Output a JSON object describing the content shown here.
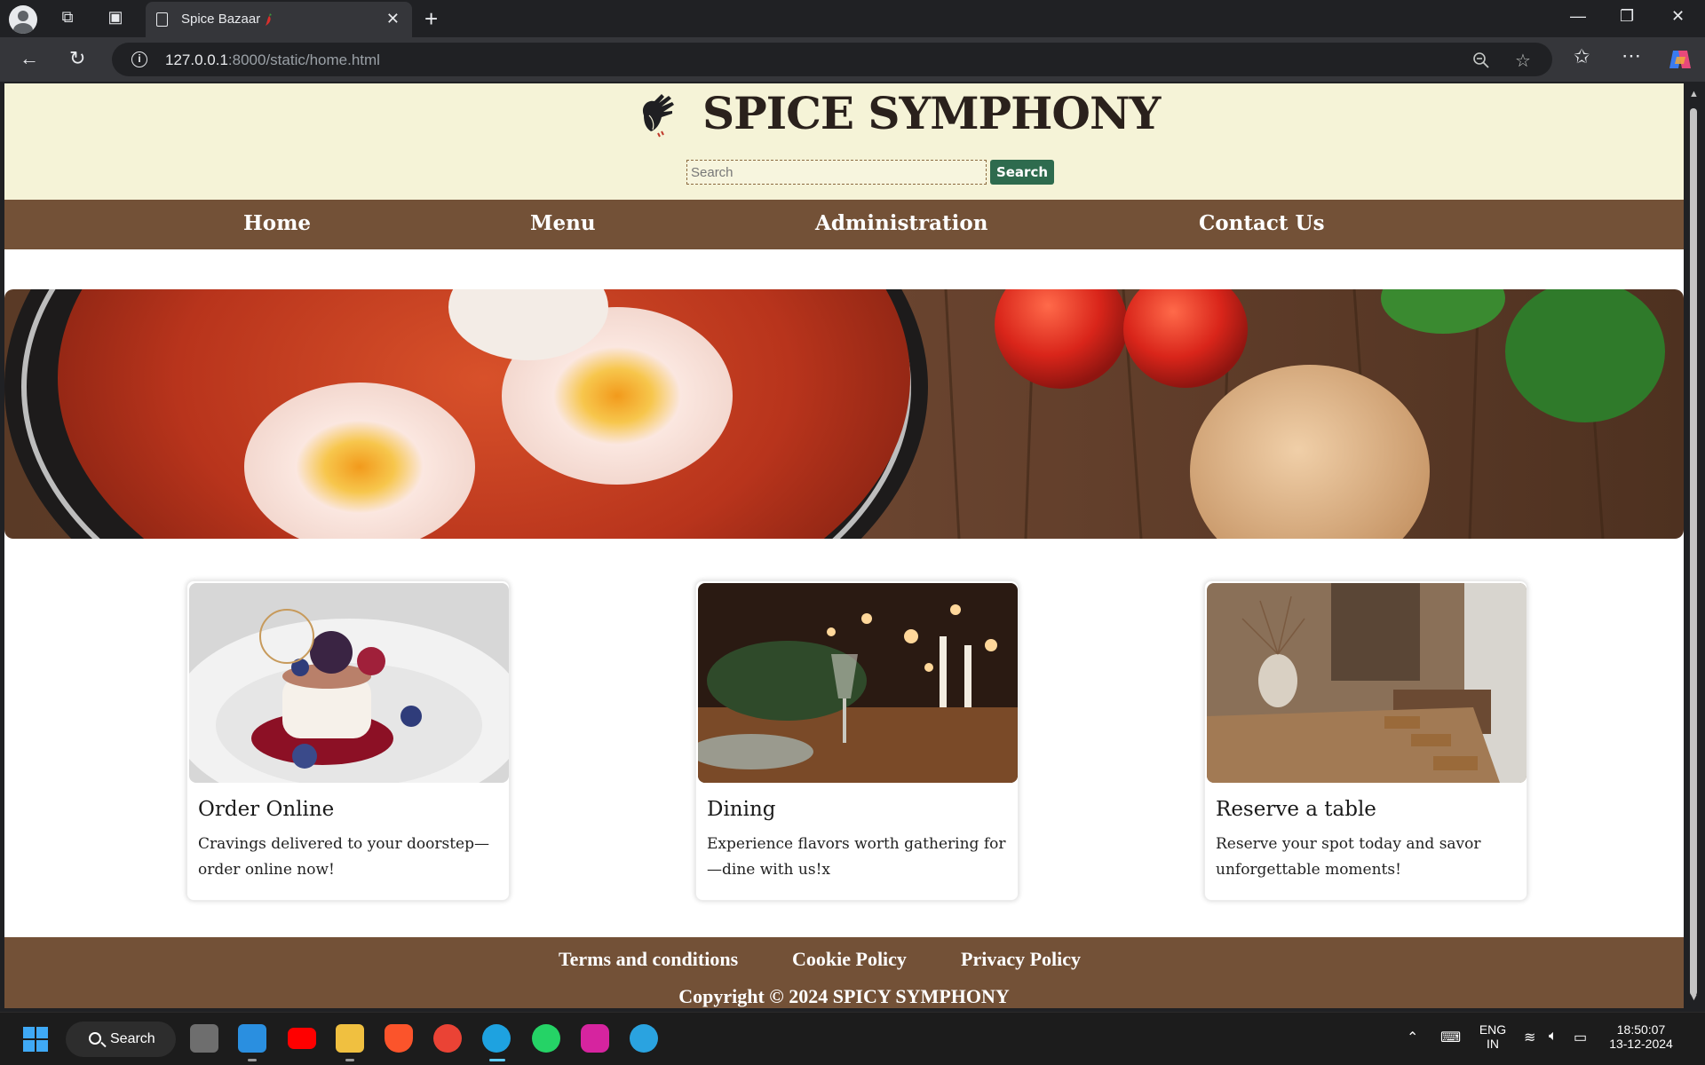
{
  "browser": {
    "tab_title": "Spice Bazaar",
    "url_host": "127.0.0.1",
    "url_rest": ":8000/static/home.html"
  },
  "site": {
    "brand": "SPICE SYMPHONY",
    "search_placeholder": "Search",
    "search_button": "Search",
    "nav": [
      "Home",
      "Menu",
      "Administration",
      "Contact Us"
    ],
    "cards": [
      {
        "title": "Order Online",
        "text": "Cravings delivered to your doorstep—order online now!"
      },
      {
        "title": "Dining",
        "text": "Experience flavors worth gathering for—dine with us!x"
      },
      {
        "title": "Reserve a table",
        "text": "Reserve your spot today and savor unforgettable moments!"
      }
    ],
    "footer_links": [
      "Terms and conditions",
      "Cookie Policy",
      "Privacy Policy"
    ],
    "copyright": "Copyright © 2024 SPICY SYMPHONY"
  },
  "taskbar": {
    "search_label": "Search",
    "lang_top": "ENG",
    "lang_bottom": "IN",
    "time": "18:50:07",
    "date": "13-12-2024"
  },
  "colors": {
    "header_bg": "#f5f3d7",
    "nav_bg": "#735137",
    "search_button_bg": "#2e6b4e"
  }
}
